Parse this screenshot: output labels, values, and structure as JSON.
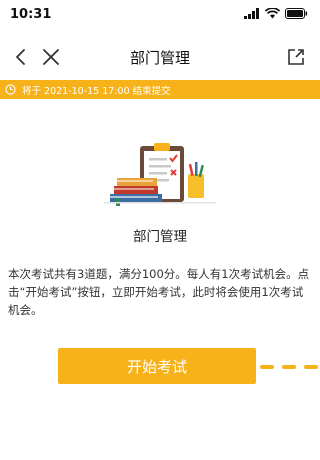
{
  "status_bar": {
    "time": "10:31"
  },
  "nav": {
    "title": "部门管理"
  },
  "deadline": {
    "text": "将于 2021-10-15 17:00 结束提交"
  },
  "quiz": {
    "title": "部门管理",
    "description": "本次考试共有3道题，满分100分。每人有1次考试机会。点击“开始考试”按钮，立即开始考试，此时将会使用1次考试机会。"
  },
  "start_button": {
    "label": "开始考试"
  },
  "colors": {
    "accent": "#f7b21a"
  },
  "icons": [
    "back-icon",
    "close-icon",
    "share-icon",
    "clock-icon",
    "signal-icon",
    "wifi-icon",
    "battery-icon",
    "exam-illustration",
    "tap-arrow"
  ]
}
